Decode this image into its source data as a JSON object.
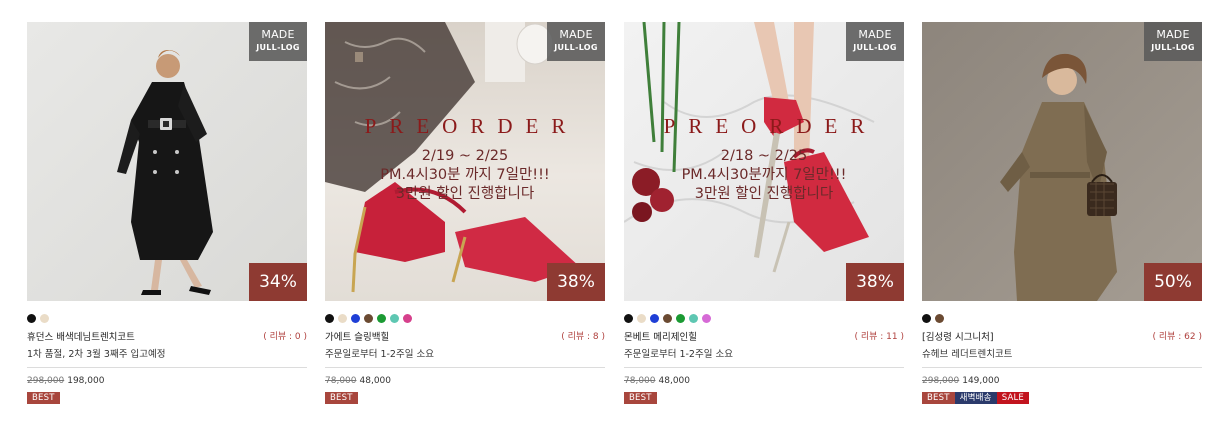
{
  "products": [
    {
      "badge_made": "MADE",
      "badge_brand": "JULL-LOG",
      "discount": "34%",
      "colors": [
        "#111111",
        "#eadcc7"
      ],
      "name": "휴던스 배색데님트렌치코트",
      "review": "( 리뷰 : 0 )",
      "sub": "1차 품절, 2차 3월 3째주 입고예정",
      "price_old": "298,000",
      "price_new": "198,000",
      "tags": [
        "BEST"
      ]
    },
    {
      "badge_made": "MADE",
      "badge_brand": "JULL-LOG",
      "discount": "38%",
      "preorder_title": "PREORDER",
      "preorder_lines": [
        "2/19 ~ 2/25",
        "PM.4시30분 까지 7일만!!!",
        "3만원 할인 진행합니다"
      ],
      "colors": [
        "#111111",
        "#eadcc7",
        "#1f3fd6",
        "#6b4a32",
        "#1b9a33",
        "#5ec7b2",
        "#d6408c"
      ],
      "name": "가에트 슬링백힐",
      "review": "( 리뷰 : 8 )",
      "sub": "주문일로부터 1-2주일 소요",
      "price_old": "78,000",
      "price_new": "48,000",
      "tags": [
        "BEST"
      ]
    },
    {
      "badge_made": "MADE",
      "badge_brand": "JULL-LOG",
      "discount": "38%",
      "preorder_title": "PREORDER",
      "preorder_lines": [
        "2/18 ~ 2/25",
        "PM.4시30분까지 7일만!!!",
        "3만원 할인 진행합니다"
      ],
      "colors": [
        "#111111",
        "#eadcc7",
        "#1f3fd6",
        "#6b4a32",
        "#1b9a33",
        "#5ec7b2",
        "#d66ad6"
      ],
      "name": "몬베트 메리제인힐",
      "review": "( 리뷰 : 11 )",
      "sub": "주문일로부터 1-2주일 소요",
      "price_old": "78,000",
      "price_new": "48,000",
      "tags": [
        "BEST"
      ]
    },
    {
      "badge_made": "MADE",
      "badge_brand": "JULL-LOG",
      "discount": "50%",
      "colors": [
        "#111111",
        "#6b4a32"
      ],
      "name": "[김성령 시그니처]",
      "review": "( 리뷰 : 62 )",
      "sub": "슈헤브 레더트렌치코트",
      "price_old": "298,000",
      "price_new": "149,000",
      "tags": [
        "BEST",
        "새벽배송",
        "SALE"
      ]
    }
  ]
}
